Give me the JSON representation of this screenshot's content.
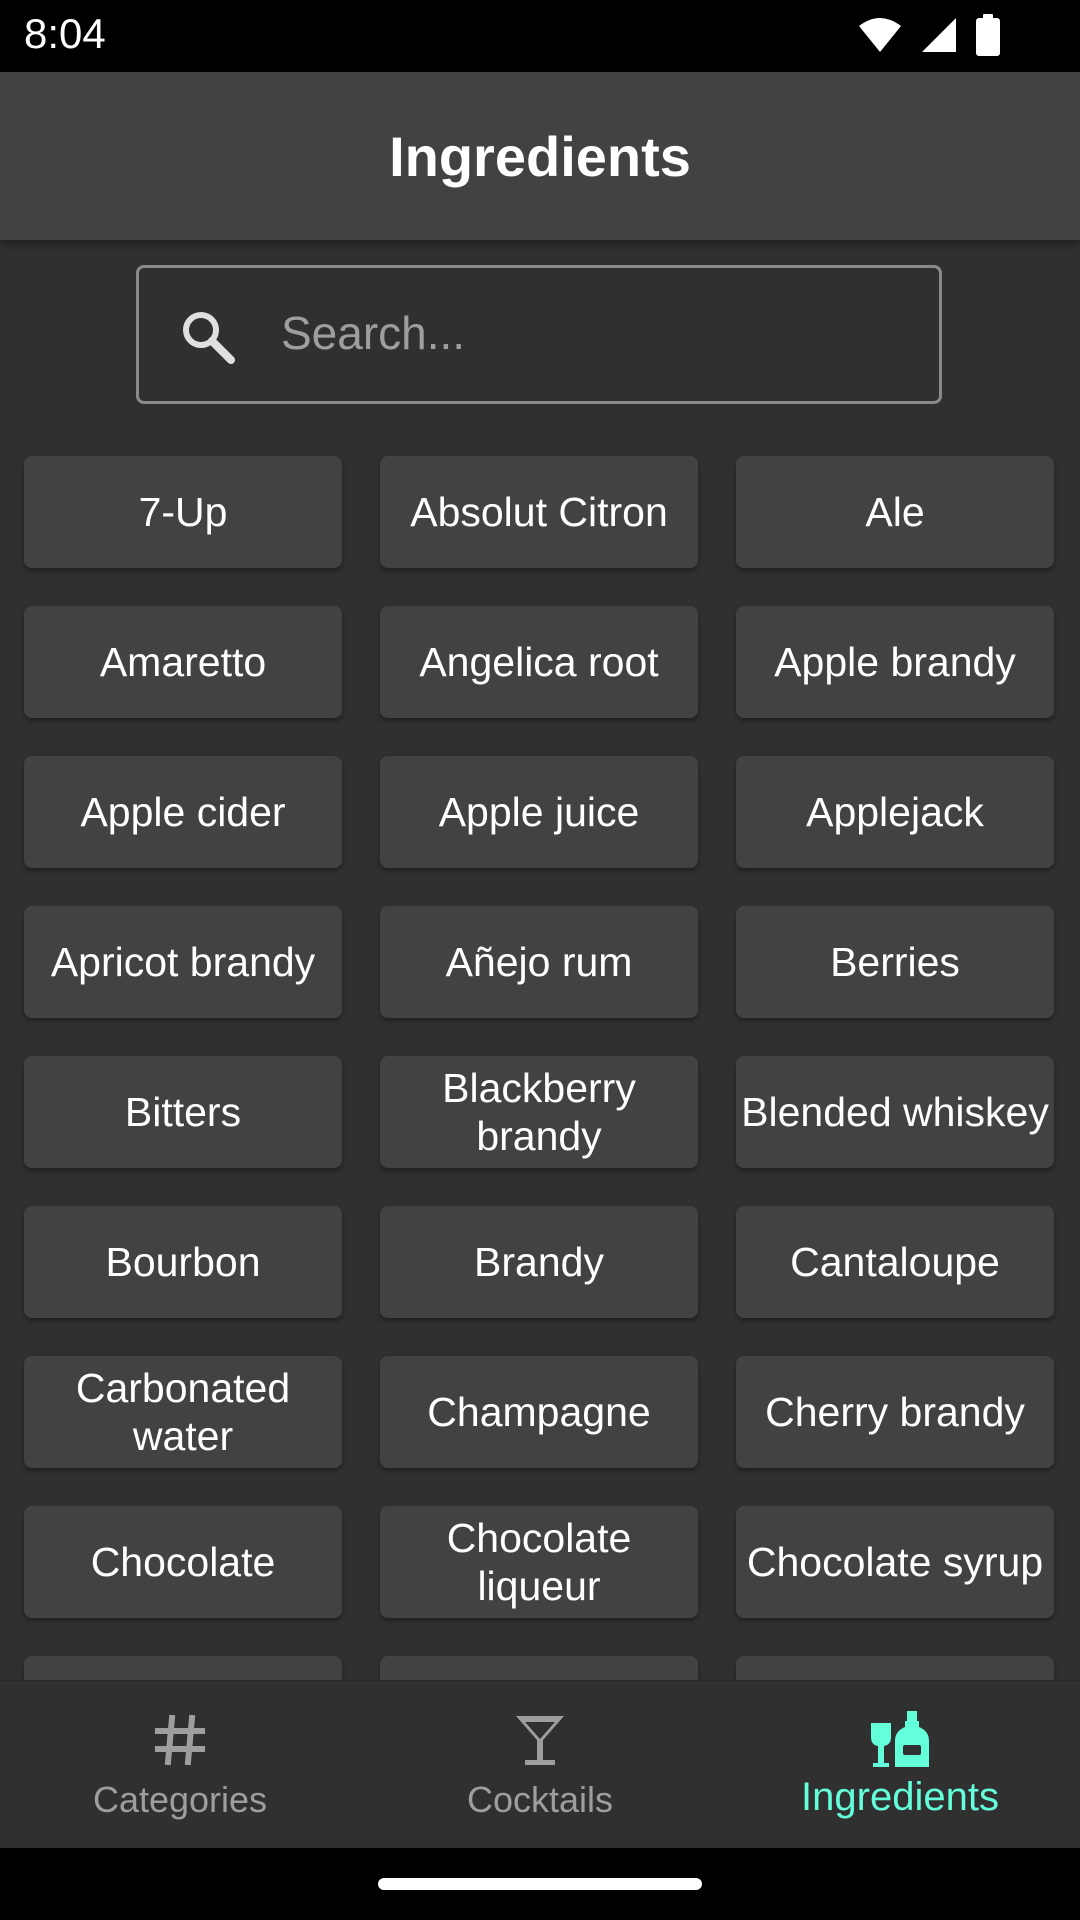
{
  "status_bar": {
    "time": "8:04",
    "icons": [
      "wifi-icon",
      "signal-icon",
      "battery-icon"
    ]
  },
  "app_bar": {
    "title": "Ingredients"
  },
  "search": {
    "placeholder": "Search...",
    "value": ""
  },
  "ingredients": [
    "7-Up",
    "Absolut Citron",
    "Ale",
    "Amaretto",
    "Angelica root",
    "Apple brandy",
    "Apple cider",
    "Apple juice",
    "Applejack",
    "Apricot brandy",
    "Añejo rum",
    "Berries",
    "Bitters",
    "Blackberry brandy",
    "Blended whiskey",
    "Bourbon",
    "Brandy",
    "Cantaloupe",
    "Carbonated water",
    "Champagne",
    "Cherry brandy",
    "Chocolate",
    "Chocolate liqueur",
    "Chocolate syrup",
    "",
    "",
    ""
  ],
  "bottom_nav": {
    "items": [
      {
        "label": "Categories",
        "icon": "hash-icon"
      },
      {
        "label": "Cocktails",
        "icon": "cocktail-glass-icon"
      },
      {
        "label": "Ingredients",
        "icon": "bottles-icon",
        "active": true
      }
    ]
  },
  "colors": {
    "accent": "#64ffda",
    "background": "#303030",
    "surface": "#424242",
    "status_bar": "#000000"
  }
}
